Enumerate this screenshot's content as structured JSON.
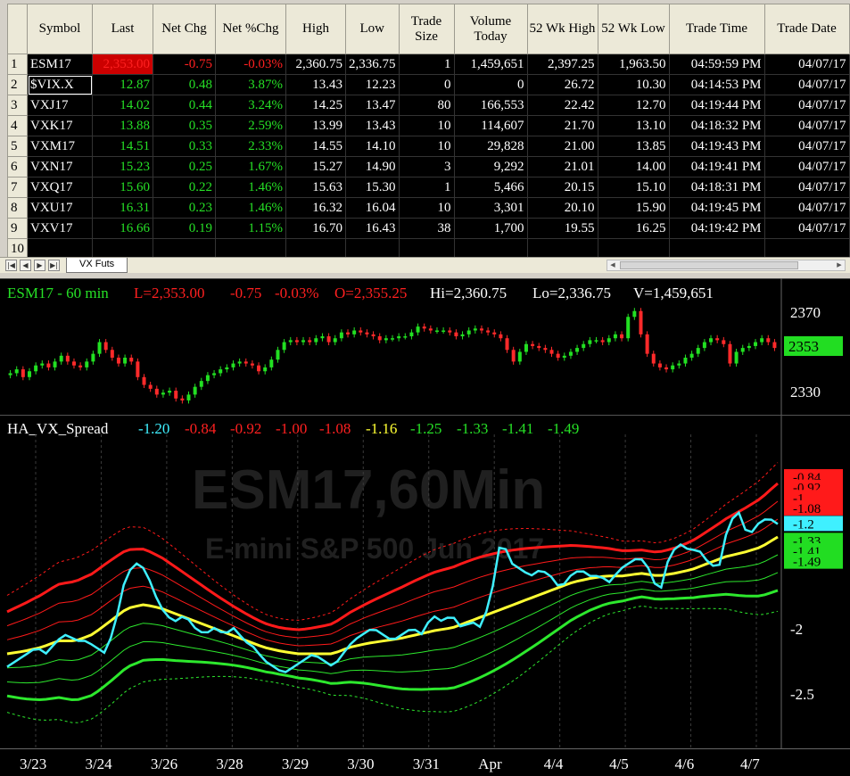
{
  "watchlist": {
    "columns": [
      "Symbol",
      "Last",
      "Net Chg",
      "Net %Chg",
      "High",
      "Low",
      "Trade Size",
      "Volume Today",
      "52 Wk High",
      "52 Wk Low",
      "Trade Time",
      "Trade Date"
    ],
    "rows": [
      {
        "n": "1",
        "symbol": "ESM17",
        "last": "2,353.00",
        "net_chg": "-0.75",
        "pct_chg": "-0.03%",
        "high": "2,360.75",
        "low": "2,336.75",
        "size": "1",
        "volume": "1,459,651",
        "wk52_high": "2,397.25",
        "wk52_low": "1,963.50",
        "time": "04:59:59 PM",
        "date": "04/07/17",
        "dir": "down"
      },
      {
        "n": "2",
        "symbol": "$VIX.X",
        "last": "12.87",
        "net_chg": "0.48",
        "pct_chg": "3.87%",
        "high": "13.43",
        "low": "12.23",
        "size": "0",
        "volume": "0",
        "wk52_high": "26.72",
        "wk52_low": "10.30",
        "time": "04:14:53 PM",
        "date": "04/07/17",
        "dir": "up"
      },
      {
        "n": "3",
        "symbol": "VXJ17",
        "last": "14.02",
        "net_chg": "0.44",
        "pct_chg": "3.24%",
        "high": "14.25",
        "low": "13.47",
        "size": "80",
        "volume": "166,553",
        "wk52_high": "22.42",
        "wk52_low": "12.70",
        "time": "04:19:44 PM",
        "date": "04/07/17",
        "dir": "up"
      },
      {
        "n": "4",
        "symbol": "VXK17",
        "last": "13.88",
        "net_chg": "0.35",
        "pct_chg": "2.59%",
        "high": "13.99",
        "low": "13.43",
        "size": "10",
        "volume": "114,607",
        "wk52_high": "21.70",
        "wk52_low": "13.10",
        "time": "04:18:32 PM",
        "date": "04/07/17",
        "dir": "up"
      },
      {
        "n": "5",
        "symbol": "VXM17",
        "last": "14.51",
        "net_chg": "0.33",
        "pct_chg": "2.33%",
        "high": "14.55",
        "low": "14.10",
        "size": "10",
        "volume": "29,828",
        "wk52_high": "21.00",
        "wk52_low": "13.85",
        "time": "04:19:43 PM",
        "date": "04/07/17",
        "dir": "up"
      },
      {
        "n": "6",
        "symbol": "VXN17",
        "last": "15.23",
        "net_chg": "0.25",
        "pct_chg": "1.67%",
        "high": "15.27",
        "low": "14.90",
        "size": "3",
        "volume": "9,292",
        "wk52_high": "21.01",
        "wk52_low": "14.00",
        "time": "04:19:41 PM",
        "date": "04/07/17",
        "dir": "up"
      },
      {
        "n": "7",
        "symbol": "VXQ17",
        "last": "15.60",
        "net_chg": "0.22",
        "pct_chg": "1.46%",
        "high": "15.63",
        "low": "15.30",
        "size": "1",
        "volume": "5,466",
        "wk52_high": "20.15",
        "wk52_low": "15.10",
        "time": "04:18:31 PM",
        "date": "04/07/17",
        "dir": "up"
      },
      {
        "n": "8",
        "symbol": "VXU17",
        "last": "16.31",
        "net_chg": "0.23",
        "pct_chg": "1.46%",
        "high": "16.32",
        "low": "16.04",
        "size": "10",
        "volume": "3,301",
        "wk52_high": "20.10",
        "wk52_low": "15.90",
        "time": "04:19:45 PM",
        "date": "04/07/17",
        "dir": "up"
      },
      {
        "n": "9",
        "symbol": "VXV17",
        "last": "16.66",
        "net_chg": "0.19",
        "pct_chg": "1.15%",
        "high": "16.70",
        "low": "16.43",
        "size": "38",
        "volume": "1,700",
        "wk52_high": "19.55",
        "wk52_low": "16.25",
        "time": "04:19:42 PM",
        "date": "04/07/17",
        "dir": "up"
      },
      {
        "n": "10",
        "symbol": "",
        "last": "",
        "net_chg": "",
        "pct_chg": "",
        "high": "",
        "low": "",
        "size": "",
        "volume": "",
        "wk52_high": "",
        "wk52_low": "",
        "time": "",
        "date": "",
        "dir": ""
      }
    ],
    "sheet_tab": "VX Futs",
    "colors": {
      "up": "#26e026",
      "down": "#ff2020"
    }
  },
  "chart_data": [
    {
      "type": "candlestick",
      "header": {
        "symbol_interval": "ESM17 - 60 min",
        "last": "L=2,353.00",
        "chg": "-0.75",
        "pct": "-0.03%",
        "open": "O=2,355.25",
        "high": "Hi=2,360.75",
        "low": "Lo=2,336.75",
        "volume": "V=1,459,651"
      },
      "y_ticks": [
        "2370",
        "2330"
      ],
      "last_price_tag": "2353",
      "ylim": [
        2320,
        2376
      ],
      "closes": [
        2340,
        2342,
        2338,
        2341,
        2344,
        2345,
        2343,
        2346,
        2349,
        2346,
        2344,
        2343,
        2346,
        2350,
        2356,
        2352,
        2348,
        2345,
        2348,
        2346,
        2338,
        2334,
        2332,
        2329,
        2330,
        2331,
        2327,
        2326,
        2329,
        2333,
        2336,
        2339,
        2340,
        2342,
        2343,
        2345,
        2346,
        2345,
        2344,
        2341,
        2343,
        2347,
        2352,
        2356,
        2357,
        2356,
        2357,
        2356,
        2358,
        2359,
        2356,
        2358,
        2361,
        2360,
        2362,
        2361,
        2360,
        2359,
        2357,
        2358,
        2358,
        2359,
        2359,
        2361,
        2364,
        2363,
        2362,
        2362,
        2362,
        2361,
        2359,
        2360,
        2362,
        2363,
        2362,
        2361,
        2360,
        2358,
        2352,
        2346,
        2351,
        2355,
        2354,
        2353,
        2352,
        2350,
        2348,
        2349,
        2351,
        2353,
        2355,
        2357,
        2357,
        2356,
        2358,
        2360,
        2358,
        2369,
        2372,
        2360,
        2350,
        2345,
        2343,
        2342,
        2344,
        2345,
        2348,
        2350,
        2353,
        2356,
        2358,
        2357,
        2355,
        2345,
        2351,
        2353,
        2354,
        2356,
        2358,
        2356,
        2353
      ]
    },
    {
      "type": "line",
      "indicator": "HA_VX_Spread",
      "band_labels": [
        "-1.20",
        "-0.84",
        "-0.92",
        "-1.00",
        "-1.08",
        "-1.16",
        "-1.25",
        "-1.33",
        "-1.41",
        "-1.49"
      ],
      "band_colors": [
        "#3ff0ff",
        "#ff1a1a",
        "#ff1a1a",
        "#ff1a1a",
        "#ff1a1a",
        "#ffff33",
        "#2de82d",
        "#2de82d",
        "#2de82d",
        "#2de82d"
      ],
      "y_ticks": [
        "-2",
        "-2.5"
      ],
      "right_tags": [
        "-0.84",
        "-0.92",
        "-1",
        "-1.08",
        "-1.2",
        "-1.33",
        "-1.41",
        "-1.49"
      ],
      "ylim": [
        -2.9,
        -0.6
      ],
      "watermark": "ESM17,60Min",
      "watermark_sub": "E-mini S&P 500 Jun 2017",
      "spread": [
        -2.3,
        -2.25,
        -2.2,
        -2.15,
        -2.2,
        -2.1,
        -2.05,
        -2.1,
        -2.1,
        -2.15,
        -2.2,
        -1.95,
        -1.6,
        -1.5,
        -1.55,
        -1.75,
        -1.9,
        -1.95,
        -1.9,
        -2.0,
        -2.05,
        -2.0,
        -2.05,
        -2.0,
        -2.1,
        -2.15,
        -2.25,
        -2.3,
        -2.35,
        -2.3,
        -2.25,
        -2.2,
        -2.25,
        -2.3,
        -2.2,
        -2.1,
        -2.05,
        -2.0,
        -2.05,
        -2.1,
        -2.05,
        -2.0,
        -2.05,
        -1.9,
        -1.95,
        -1.9,
        -2.0,
        -1.95,
        -2.0,
        -1.75,
        -1.3,
        -1.5,
        -1.55,
        -1.6,
        -1.55,
        -1.6,
        -1.7,
        -1.6,
        -1.55,
        -1.6,
        -1.6,
        -1.65,
        -1.55,
        -1.5,
        -1.45,
        -1.55,
        -1.75,
        -1.45,
        -1.35,
        -1.4,
        -1.4,
        -1.5,
        -1.55,
        -1.2,
        -1.1,
        -1.3,
        -1.2,
        -1.15,
        -1.2
      ],
      "mid": [
        -2.2,
        -2.18,
        -2.15,
        -2.1,
        -2.1,
        -2.05,
        -1.95,
        -1.85,
        -1.82,
        -1.85,
        -1.9,
        -1.95,
        -2.0,
        -2.05,
        -2.1,
        -2.15,
        -2.18,
        -2.2,
        -2.2,
        -2.2,
        -2.15,
        -2.12,
        -2.1,
        -2.08,
        -2.05,
        -2.02,
        -2.0,
        -1.95,
        -1.9,
        -1.85,
        -1.8,
        -1.75,
        -1.7,
        -1.65,
        -1.62,
        -1.6,
        -1.6,
        -1.58,
        -1.6,
        -1.58,
        -1.55,
        -1.5,
        -1.45,
        -1.42,
        -1.38,
        -1.3
      ],
      "band_offsets": [
        0.5,
        0.36,
        0.24,
        0.12,
        -0.12,
        -0.24,
        -0.36,
        -0.5
      ],
      "x_ticks": [
        "3/23",
        "3/24",
        "3/26",
        "3/28",
        "3/29",
        "3/30",
        "3/31",
        "Apr",
        "4/4",
        "4/5",
        "4/6",
        "4/7"
      ]
    }
  ]
}
